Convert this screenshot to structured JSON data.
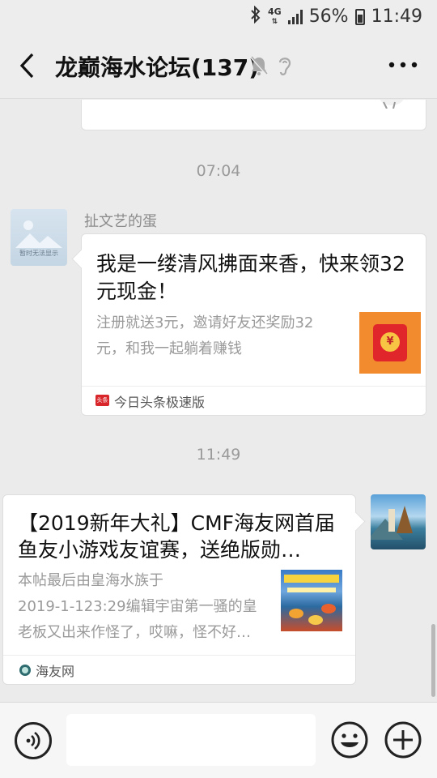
{
  "status_bar": {
    "network": "4G",
    "battery": "56%",
    "time": "11:49",
    "icons": [
      "bluetooth-icon",
      "network-4g-icon",
      "signal-icon",
      "battery-icon"
    ]
  },
  "nav": {
    "title": "龙巅海水论坛(137)",
    "icons": [
      "back-icon",
      "mute-icon",
      "ear-icon",
      "more-icon"
    ]
  },
  "chat": {
    "timestamps": [
      "07:04",
      "11:49"
    ],
    "messages": [
      {
        "sender": "扯文艺的蛋",
        "avatar_caption": "暂时无法显示",
        "card": {
          "title": "我是一缕清风拂面来香，快来领32元现金！",
          "description": "注册就送3元，邀请好友还奖励32元，和我一起躺着赚钱",
          "thumbnail_icon": "red-envelope-icon",
          "source": "今日头条极速版",
          "source_icon_text": "头条"
        }
      },
      {
        "sender": "self",
        "card": {
          "title": "【2019新年大礼】CMF海友网首届鱼友小游戏友谊赛，送绝版勋…",
          "description_lines": [
            "本帖最后由皇海水族于",
            "2019-1-123:29编辑宇宙第一骚的皇",
            "老板又出来作怪了，哎嘛，怪不好…"
          ],
          "thumbnail_icon": "fish-game-thumbnail",
          "source": "海友网"
        }
      }
    ]
  },
  "input_bar": {
    "placeholder": "",
    "icons": [
      "voice-icon",
      "emoji-icon",
      "plus-icon"
    ]
  },
  "colors": {
    "background": "#ebebeb",
    "bubble": "#ffffff",
    "timestamp": "#9a9a9a",
    "red_packet_bg": "#f28a2e",
    "red_packet": "#e0262a"
  }
}
